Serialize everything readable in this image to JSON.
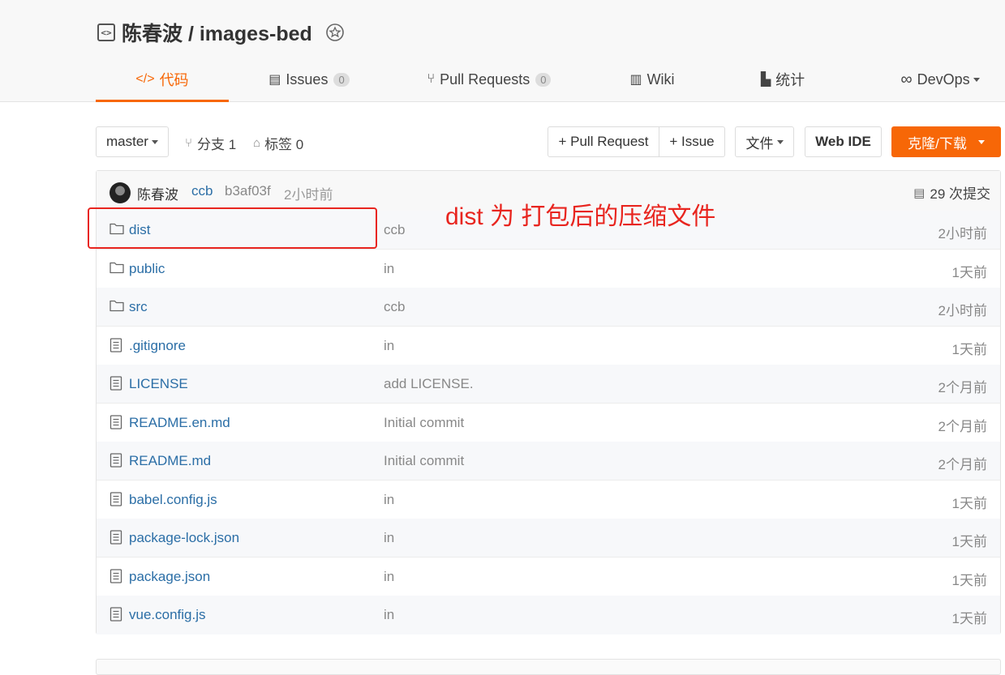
{
  "repo": {
    "owner_and_name": "陈春波 / images-bed"
  },
  "tabs": [
    {
      "label": "代码",
      "icon": "code-icon"
    },
    {
      "label": "Issues",
      "count": "0",
      "icon": "issues-icon"
    },
    {
      "label": "Pull Requests",
      "count": "0",
      "icon": "pull-request-icon"
    },
    {
      "label": "Wiki",
      "icon": "book-icon"
    },
    {
      "label": "统计",
      "icon": "chart-icon"
    },
    {
      "label": "DevOps",
      "icon": "infinity-icon"
    }
  ],
  "toolbar": {
    "branch": "master",
    "branches": "分支 1",
    "tags": "标签 0",
    "pull_request": "+ Pull Request",
    "issue": "+ Issue",
    "files": "文件",
    "web_ide": "Web IDE",
    "clone": "克隆/下载"
  },
  "commit": {
    "author": "陈春波",
    "user": "ccb",
    "hash": "b3af03f",
    "time": "2小时前",
    "count": "29 次提交"
  },
  "files": [
    {
      "name": "dist",
      "type": "folder",
      "message": "ccb",
      "time": "2小时前"
    },
    {
      "name": "public",
      "type": "folder",
      "message": "in",
      "time": "1天前"
    },
    {
      "name": "src",
      "type": "folder",
      "message": "ccb",
      "time": "2小时前"
    },
    {
      "name": ".gitignore",
      "type": "file",
      "message": "in",
      "time": "1天前"
    },
    {
      "name": "LICENSE",
      "type": "file",
      "message": "add LICENSE.",
      "time": "2个月前"
    },
    {
      "name": "README.en.md",
      "type": "file",
      "message": "Initial commit",
      "time": "2个月前"
    },
    {
      "name": "README.md",
      "type": "file",
      "message": "Initial commit",
      "time": "2个月前"
    },
    {
      "name": "babel.config.js",
      "type": "file",
      "message": "in",
      "time": "1天前"
    },
    {
      "name": "package-lock.json",
      "type": "file",
      "message": "in",
      "time": "1天前"
    },
    {
      "name": "package.json",
      "type": "file",
      "message": "in",
      "time": "1天前"
    },
    {
      "name": "vue.config.js",
      "type": "file",
      "message": "in",
      "time": "1天前"
    }
  ],
  "annotation": {
    "text": "dist 为 打包后的压缩文件"
  },
  "colors": {
    "accent": "#f76707",
    "link": "#2b6ea6",
    "annotation": "#e8251f"
  }
}
